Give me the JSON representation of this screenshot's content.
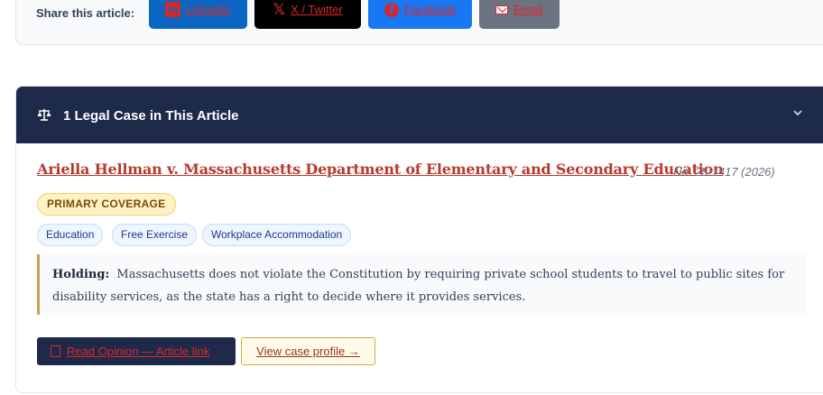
{
  "share": {
    "label": "Share this article:",
    "buttons": [
      {
        "label": "LinkedIn",
        "icon": "linkedin-icon",
        "color": "#0a66c2"
      },
      {
        "label": "X / Twitter",
        "icon": "x-icon",
        "color": "#000000"
      },
      {
        "label": "Facebook",
        "icon": "facebook-icon",
        "color": "#1877f2"
      },
      {
        "label": "Email",
        "icon": "mail-icon",
        "color": "#6b7280"
      }
    ]
  },
  "cases": {
    "header_title": "1 Legal Case in This Article",
    "header_icon": "scale-icon",
    "toggle_icon": "chevron-down-icon",
    "header_color": "#1e2a4a",
    "items": [
      {
        "title": "Ariella Hellman v. Massachusetts Department of Elementary and Secondary Education",
        "meta": "No. 25-1417 (2026)",
        "badge": "PRIMARY COVERAGE",
        "tags": [
          "Education",
          "Free Exercise",
          "Workplace Accommodation"
        ],
        "holding_label": "Holding:",
        "holding_text": "Massachusetts does not violate the Constitution by requiring private school students to travel to public sites for disability services, as the state has a right to decide where it provides services.",
        "opinion_button": "Read Opinion — Article link",
        "profile_button": "View case profile →"
      }
    ]
  }
}
